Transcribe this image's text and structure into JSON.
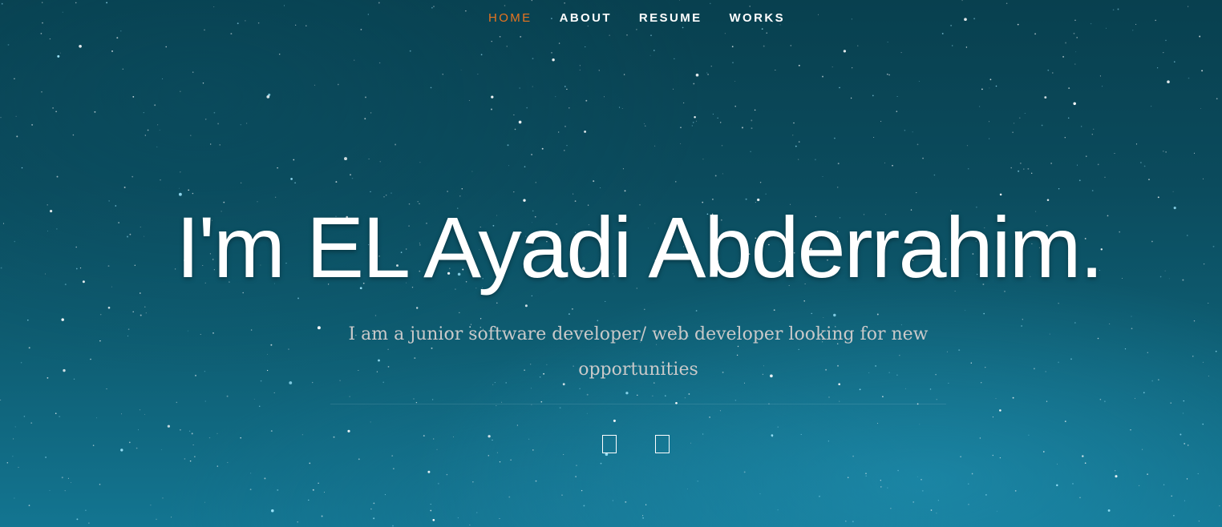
{
  "nav": {
    "items": [
      {
        "label": "HOME",
        "current": true
      },
      {
        "label": "ABOUT",
        "current": false
      },
      {
        "label": "RESUME",
        "current": false
      },
      {
        "label": "WORKS",
        "current": false
      }
    ]
  },
  "hero": {
    "title": "I'm EL Ayadi Abderrahim.",
    "subtitle": "I am a junior software developer/ web developer looking for new opportunities"
  },
  "social": {
    "icons": [
      "social-icon-placeholder",
      "social-icon-placeholder"
    ]
  },
  "colors": {
    "accent": "#e8741f",
    "text": "#ffffff",
    "subtitle": "#c9c9c9",
    "sky_top": "#08404f",
    "sky_bottom": "#137591"
  }
}
